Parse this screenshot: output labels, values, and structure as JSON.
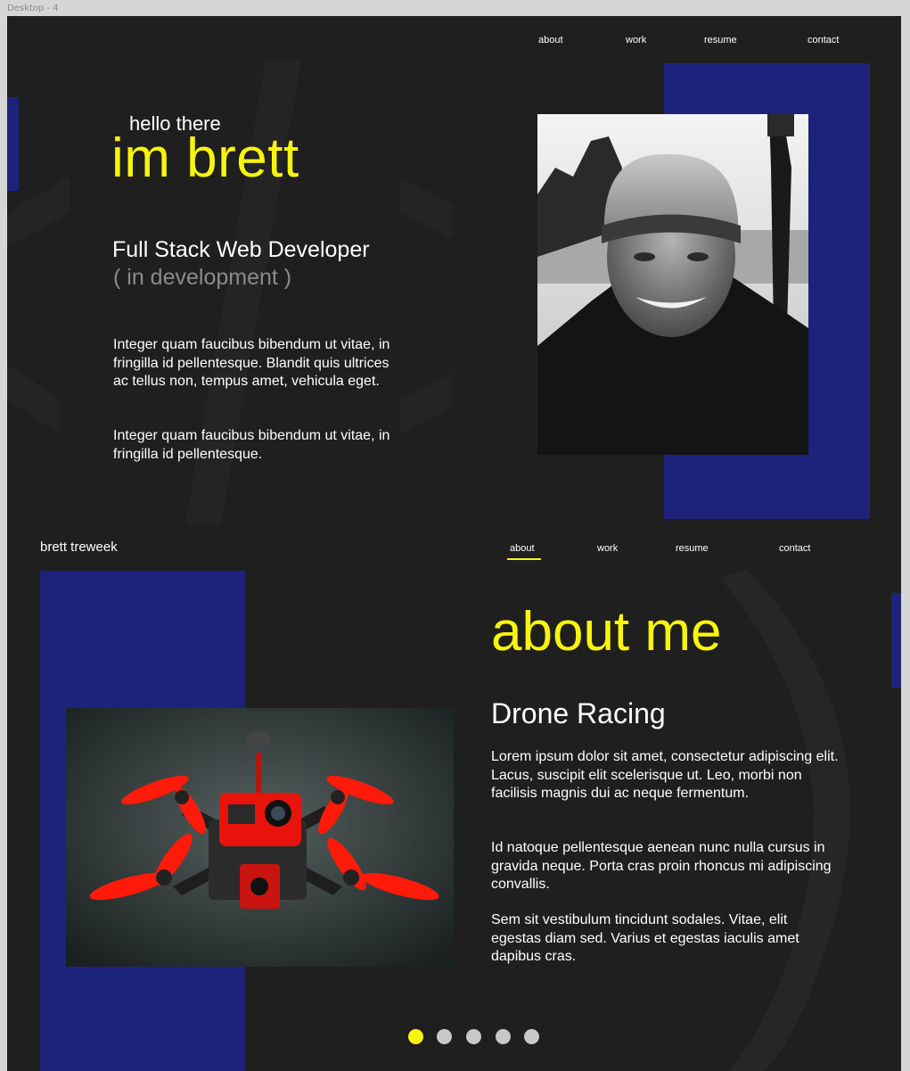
{
  "frame": {
    "label": "Desktop - 4"
  },
  "hero": {
    "nav": {
      "about": "about",
      "work": "work",
      "resume": "resume",
      "contact": "contact"
    },
    "greeting": "hello there",
    "name": "im brett",
    "role": "Full Stack Web Developer",
    "role_note": "( in development )",
    "paragraph1": "Integer quam faucibus bibendum ut vitae, in fringilla id pellentesque. Blandit quis ultrices ac tellus non, tempus amet, vehicula eget.",
    "paragraph2": "Integer quam faucibus bibendum ut vitae, in fringilla id pellentesque."
  },
  "about": {
    "brand": "brett treweek",
    "nav": {
      "about": "about",
      "work": "work",
      "resume": "resume",
      "contact": "contact",
      "active": "about"
    },
    "title": "about me",
    "subtitle": "Drone Racing",
    "paragraph1": "Lorem ipsum dolor sit amet, consectetur adipiscing elit. Lacus, suscipit elit scelerisque ut. Leo, morbi non facilisis magnis dui ac neque fermentum.",
    "paragraph2": "Id natoque pellentesque aenean nunc nulla cursus in gravida neque. Porta cras proin rhoncus mi adipiscing convallis.",
    "paragraph3": "Sem sit vestibulum tincidunt sodales. Vitae, elit egestas diam sed. Varius et egestas iaculis amet dapibus cras."
  },
  "carousel": {
    "count": 5,
    "active_index": 0
  },
  "colors": {
    "accent": "#f7f40d",
    "blue": "#1d237a",
    "background": "#1f1f1f"
  }
}
